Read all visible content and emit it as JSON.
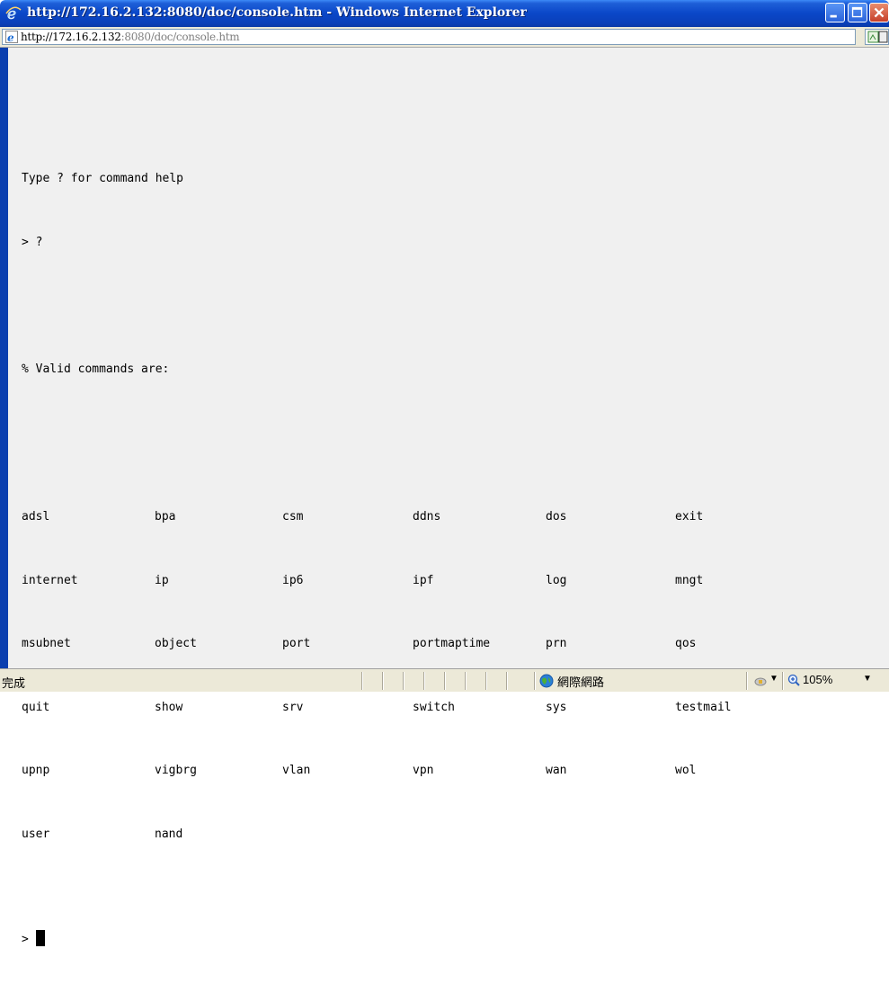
{
  "window": {
    "title": "http://172.16.2.132:8080/doc/console.htm - Windows Internet Explorer"
  },
  "address": {
    "host_part": "http://172.16.2.132",
    "path_part": ":8080/doc/console.htm"
  },
  "console": {
    "lines": [
      "Type ? for command help",
      "> ?",
      "",
      "% Valid commands are:"
    ],
    "commands": [
      [
        "adsl",
        "bpa",
        "csm",
        "ddns",
        "dos",
        "exit"
      ],
      [
        "internet",
        "ip",
        "ip6",
        "ipf",
        "log",
        "mngt"
      ],
      [
        "msubnet",
        "object",
        "port",
        "portmaptime",
        "prn",
        "qos"
      ],
      [
        "quit",
        "show",
        "srv",
        "switch",
        "sys",
        "testmail"
      ],
      [
        "upnp",
        "vigbrg",
        "vlan",
        "vpn",
        "wan",
        "wol"
      ],
      [
        "user",
        "nand"
      ]
    ],
    "prompt": ">"
  },
  "statusbar": {
    "status": "完成",
    "zone": "網際網路",
    "zoom": "105%"
  },
  "colors": {
    "titlebar": "#0a47c8",
    "frame": "#0b3faf",
    "console_bg": "#f0f0f0",
    "close_button": "#c7402a"
  },
  "icons": [
    "ie-logo-icon",
    "minimize-icon",
    "maximize-icon",
    "close-icon",
    "page-icon",
    "globe-icon",
    "protected-mode-icon",
    "zoom-icon",
    "dropdown-arrow-icon"
  ]
}
